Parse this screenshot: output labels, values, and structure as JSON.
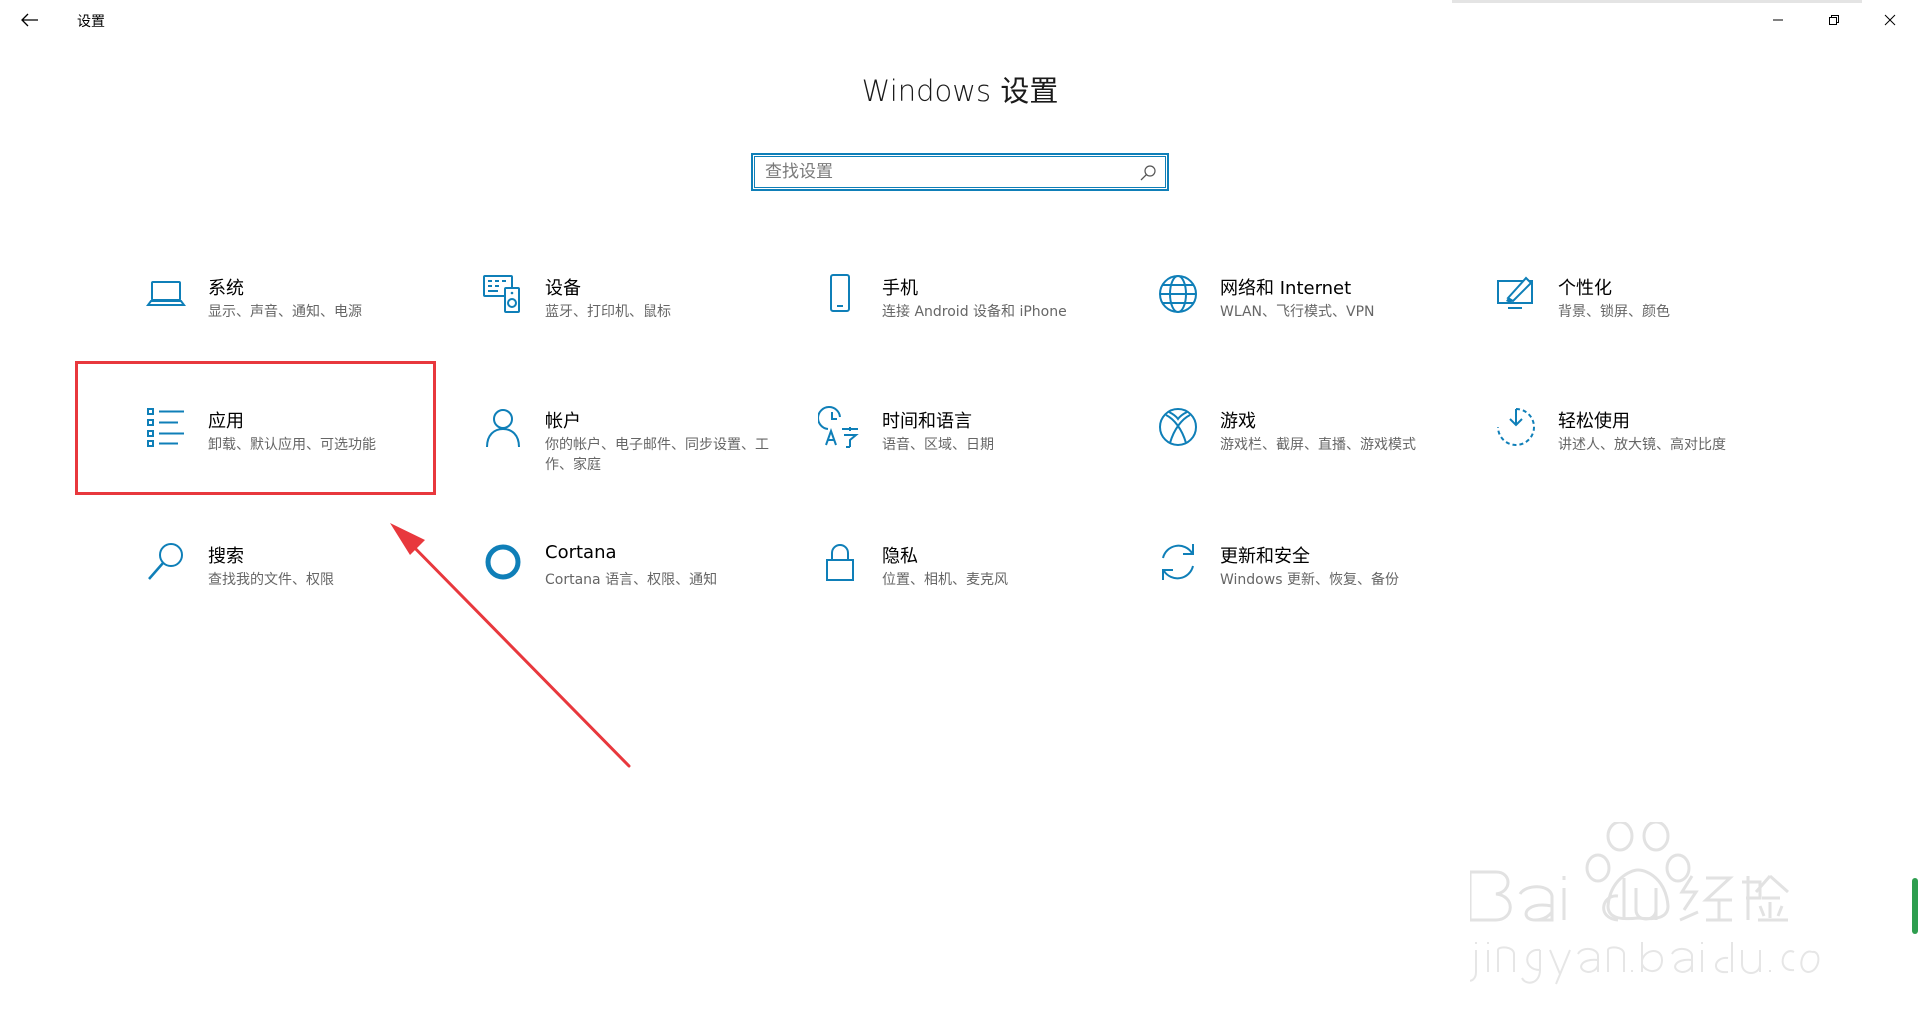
{
  "window": {
    "title": "设置"
  },
  "header": {
    "title": "Windows 设置"
  },
  "search": {
    "placeholder": "查找设置",
    "value": ""
  },
  "categories": [
    {
      "title": "系统",
      "desc": "显示、声音、通知、电源",
      "icon": "laptop-icon"
    },
    {
      "title": "设备",
      "desc": "蓝牙、打印机、鼠标",
      "icon": "devices-icon"
    },
    {
      "title": "手机",
      "desc": "连接 Android 设备和 iPhone",
      "icon": "phone-icon"
    },
    {
      "title": "网络和 Internet",
      "desc": "WLAN、飞行模式、VPN",
      "icon": "globe-icon"
    },
    {
      "title": "个性化",
      "desc": "背景、锁屏、颜色",
      "icon": "personalization-icon"
    },
    {
      "title": "应用",
      "desc": "卸载、默认应用、可选功能",
      "icon": "apps-list-icon"
    },
    {
      "title": "帐户",
      "desc": "你的帐户、电子邮件、同步设置、工作、家庭",
      "icon": "person-icon"
    },
    {
      "title": "时间和语言",
      "desc": "语音、区域、日期",
      "icon": "time-language-icon"
    },
    {
      "title": "游戏",
      "desc": "游戏栏、截屏、直播、游戏模式",
      "icon": "xbox-icon"
    },
    {
      "title": "轻松使用",
      "desc": "讲述人、放大镜、高对比度",
      "icon": "ease-of-access-icon"
    },
    {
      "title": "搜索",
      "desc": "查找我的文件、权限",
      "icon": "search-magnifier-icon"
    },
    {
      "title": "Cortana",
      "desc": "Cortana 语言、权限、通知",
      "icon": "cortana-icon"
    },
    {
      "title": "隐私",
      "desc": "位置、相机、麦克风",
      "icon": "lock-icon"
    },
    {
      "title": "更新和安全",
      "desc": "Windows 更新、恢复、备份",
      "icon": "update-icon"
    }
  ],
  "watermark": {
    "brand": "Baidu经验",
    "url": "jingyan.baidu.com"
  },
  "colors": {
    "accent": "#0f7fb8",
    "annotation": "#e8383d"
  }
}
